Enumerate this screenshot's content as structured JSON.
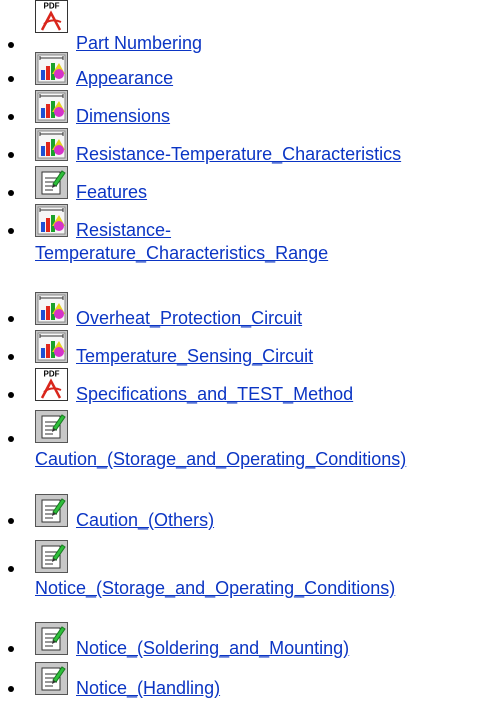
{
  "colors": {
    "link": "#0b35c4",
    "bullet": "#000000"
  },
  "documents": [
    {
      "icon": "pdf-icon",
      "label": " Part Numbering"
    },
    {
      "icon": "chart-icon",
      "label": " Appearance"
    },
    {
      "icon": "chart-icon",
      "label": " Dimensions"
    },
    {
      "icon": "chart-icon",
      "label": " Resistance-Temperature_Characteristics"
    },
    {
      "icon": "note-icon",
      "label": " Features"
    },
    {
      "icon": "chart-icon",
      "label_line1": " Resistance-",
      "label_line2": "Temperature_Characteristics_Range"
    },
    {
      "icon": "chart-icon",
      "label": " Overheat_Protection_Circuit"
    },
    {
      "icon": "chart-icon",
      "label": " Temperature_Sensing_Circuit"
    },
    {
      "icon": "pdf-icon",
      "label": " Specifications_and_TEST_Method"
    },
    {
      "icon": "note-icon",
      "label": "Caution_(Storage_and_Operating_Conditions)"
    },
    {
      "icon": "note-icon",
      "label": " Caution_(Others)"
    },
    {
      "icon": "note-icon",
      "label": "Notice_(Storage_and_Operating_Conditions)"
    },
    {
      "icon": "note-icon",
      "label": " Notice_(Soldering_and_Mounting)"
    },
    {
      "icon": "note-icon",
      "label": " Notice_(Handling)"
    }
  ]
}
